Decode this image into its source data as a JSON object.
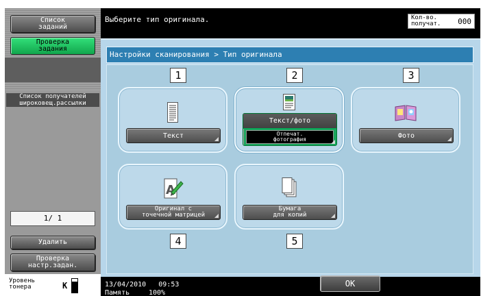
{
  "sidebar": {
    "job_list_line1": "Список",
    "job_list_line2": "заданий",
    "check_job_line1": "Проверка",
    "check_job_line2": "задания",
    "broadcast_line1": "Список получателей",
    "broadcast_line2": "широковещ.рассылки",
    "page_counter": "1/  1",
    "delete_label": "Удалить",
    "check_settings_line1": "Проверка",
    "check_settings_line2": "настр.задан.",
    "toner_line1": "Уровень",
    "toner_line2": "тонера",
    "toner_color": "K",
    "toner_level": 0.8
  },
  "header": {
    "instruction": "Выберите тип оригинала.",
    "copies_label_line1": "Кол-во.",
    "copies_label_line2": "получат.",
    "copies_value": "000"
  },
  "main": {
    "breadcrumb": "Настройки сканирования > Тип оригинала",
    "options": [
      {
        "number": "1",
        "label": "Текст",
        "icon": "text-page-icon"
      },
      {
        "number": "2",
        "label": "Текст/фото",
        "sub_line1": "Отпечат.",
        "sub_line2": "фотография",
        "icon": "text-photo-page-icon",
        "selected": true
      },
      {
        "number": "3",
        "label": "Фото",
        "icon": "photo-book-icon"
      },
      {
        "number": "4",
        "label_line1": "Оригинал с",
        "label_line2": "точечной матрицей",
        "icon": "dot-matrix-page-icon"
      },
      {
        "number": "5",
        "label_line1": "Бумага",
        "label_line2": "для копий",
        "icon": "copy-paper-stack-icon"
      }
    ],
    "ok_label": "OK"
  },
  "footer": {
    "date": "13/04/2010",
    "time": "09:53",
    "memory_label": "Память",
    "memory_value": "100%"
  },
  "colors": {
    "panel_bg": "#b7d6ea",
    "breadcrumb_bg": "#2d7fb2",
    "selected_green": "#1aa55d",
    "accent_green": "#12a64d"
  }
}
